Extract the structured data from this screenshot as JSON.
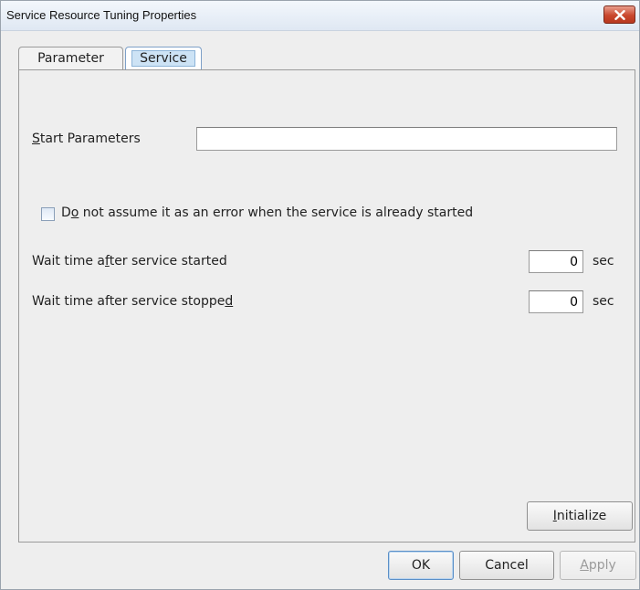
{
  "window": {
    "title": "Service Resource Tuning Properties"
  },
  "tabs": [
    {
      "label": "Parameter",
      "selected": false
    },
    {
      "label": "Service",
      "selected": true
    }
  ],
  "service": {
    "start_parameters": {
      "label_mnemonic": "S",
      "label_rest": "tart Parameters",
      "value": ""
    },
    "already_started_check": {
      "label_pre": "D",
      "label_mnemonic": "o",
      "label_post": " not assume it as an error when the service is already started",
      "checked": false
    },
    "wait_after_started": {
      "label_pre": "Wait time a",
      "label_mnemonic": "f",
      "label_post": "ter service started",
      "value": "0",
      "unit": "sec"
    },
    "wait_after_stopped": {
      "label_pre": "Wait time after service stoppe",
      "label_mnemonic": "d",
      "label_post": "",
      "value": "0",
      "unit": "sec"
    },
    "initialize": {
      "mnemonic": "I",
      "rest": "nitialize"
    }
  },
  "footer": {
    "ok": "OK",
    "cancel": "Cancel",
    "apply_mnemonic": "A",
    "apply_rest": "pply"
  },
  "icons": {
    "close": "close-icon"
  },
  "colors": {
    "close_button": "#c9472d",
    "tab_selected_highlight": "#cde3f5"
  }
}
